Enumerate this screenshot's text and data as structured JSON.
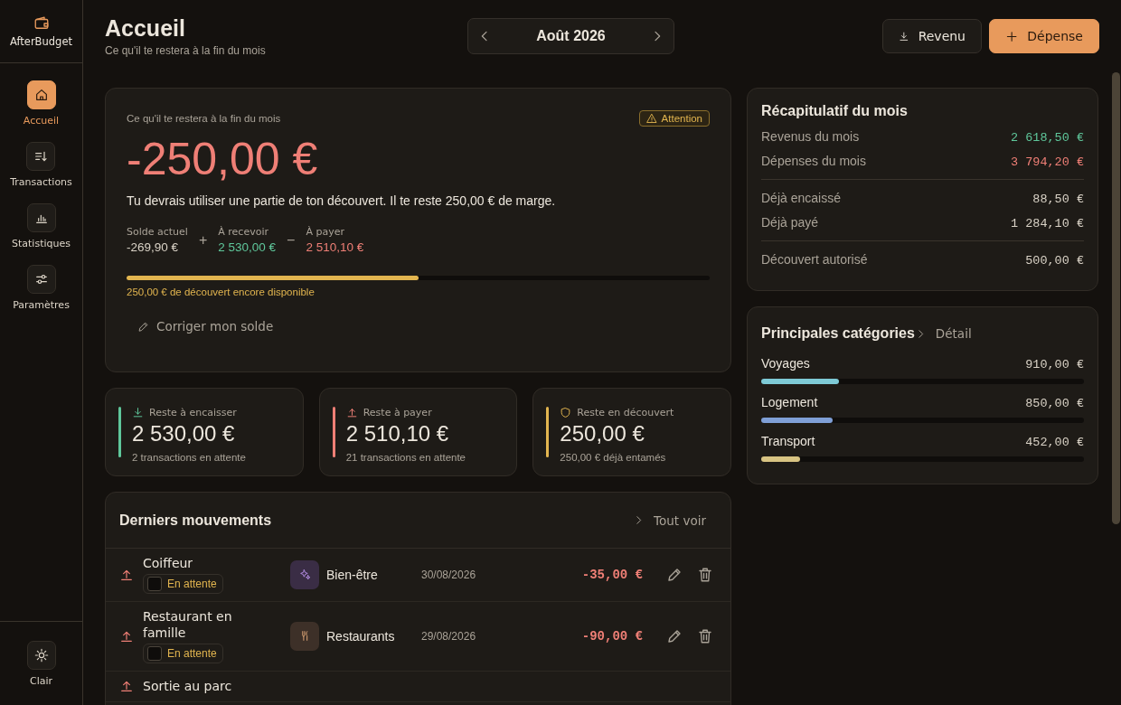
{
  "app": {
    "name": "AfterBudget"
  },
  "sidebar": {
    "items": [
      {
        "label": "Accueil",
        "selected": true
      },
      {
        "label": "Transactions",
        "selected": false
      },
      {
        "label": "Statistiques",
        "selected": false
      },
      {
        "label": "Paramètres",
        "selected": false
      }
    ],
    "theme_toggle": {
      "label": "Clair"
    }
  },
  "header": {
    "title": "Accueil",
    "subtitle": "Ce qu'il te restera à la fin du mois",
    "month": "Août 2026",
    "buttons": [
      {
        "label": "Revenu",
        "kind": "income"
      },
      {
        "label": "Dépense",
        "kind": "expense"
      }
    ]
  },
  "forecast": {
    "label": "Ce qu'il te restera à la fin du mois",
    "badge": "Attention",
    "amount": "-250,00 €",
    "message": "Tu devrais utiliser une partie de ton découvert. Il te reste 250,00 € de marge.",
    "terms": [
      {
        "label": "Solde actuel",
        "value": "-269,90 €",
        "kind": "neutral"
      },
      {
        "op": "+",
        "label": "À recevoir",
        "value": "2 530,00 €",
        "kind": "income"
      },
      {
        "op": "−",
        "label": "À payer",
        "value": "2 510,10 €",
        "kind": "expense"
      }
    ],
    "overdraft": {
      "level": 0.5,
      "caption": "250,00 € de découvert encore disponible"
    },
    "correct_link": "Corriger mon solde"
  },
  "stat_cards": [
    {
      "kind": "income",
      "label": "Reste à encaisser",
      "value": "2 530,00 €",
      "note": "2 transactions en attente"
    },
    {
      "kind": "expense",
      "label": "Reste à payer",
      "value": "2 510,10 €",
      "note": "21 transactions en attente"
    },
    {
      "kind": "overdraft",
      "label": "Reste en découvert",
      "value": "250,00 €",
      "note": "250,00 € déjà entamés"
    }
  ],
  "movements": {
    "title": "Derniers mouvements",
    "link": "Tout voir",
    "rows": [
      {
        "kind": "expense",
        "name": "Coiffeur",
        "status": "En attente",
        "checked": false,
        "category": "Bien-être",
        "date": "30/08/2026",
        "amount": "-35,00 €"
      },
      {
        "kind": "expense",
        "name": "Restaurant en famille",
        "status": "En attente",
        "checked": false,
        "category": "Restaurants",
        "date": "29/08/2026",
        "amount": "-90,00 €"
      },
      {
        "kind": "expense",
        "name": "Sortie au parc"
      }
    ]
  },
  "summary": {
    "title": "Récapitulatif du mois",
    "groups": [
      [
        {
          "label": "Revenus du mois",
          "value": "2 618,50 €",
          "kind": "income"
        },
        {
          "label": "Dépenses du mois",
          "value": "3 794,20 €",
          "kind": "expense"
        }
      ],
      [
        {
          "label": "Déjà encaissé",
          "value": "88,50 €",
          "kind": "neutral"
        },
        {
          "label": "Déjà payé",
          "value": "1 284,10 €",
          "kind": "neutral"
        }
      ],
      [
        {
          "label": "Découvert autorisé",
          "value": "500,00 €",
          "kind": "neutral"
        }
      ]
    ]
  },
  "categories": {
    "title": "Principales catégories",
    "link": "Détail",
    "items": [
      {
        "name": "Voyages",
        "value": "910,00 €",
        "level": 0.24,
        "color": "#7ecad6"
      },
      {
        "name": "Logement",
        "value": "850,00 €",
        "level": 0.22,
        "color": "#7f9fd6"
      },
      {
        "name": "Transport",
        "value": "452,00 €",
        "level": 0.12,
        "color": "#d8c483"
      }
    ]
  }
}
